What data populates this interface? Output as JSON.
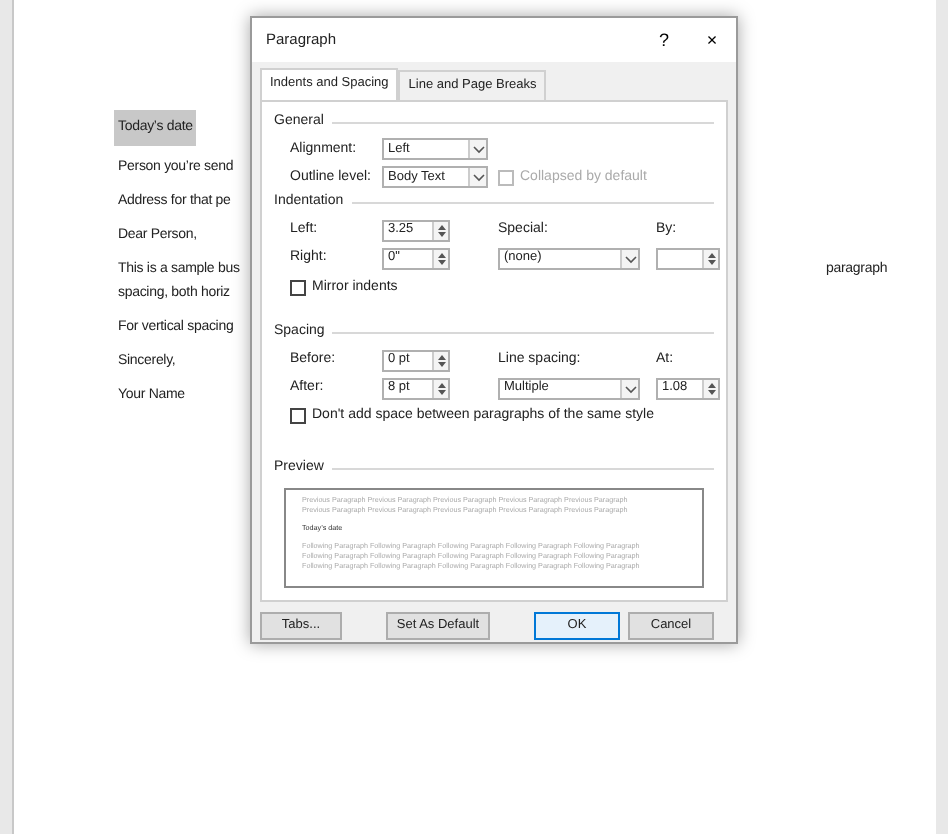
{
  "document": {
    "paragraphs": [
      {
        "lines": [
          "Today’s date"
        ],
        "highlighted": true
      },
      {
        "lines": [
          "Person you’re send"
        ],
        "highlighted": false
      },
      {
        "lines": [
          "Address for that pe"
        ],
        "highlighted": false
      },
      {
        "lines": [
          "Dear Person,"
        ],
        "highlighted": false
      },
      {
        "lines": [
          "This is a sample bus",
          "spacing, both horiz"
        ],
        "highlighted": false,
        "continuation": "paragraph"
      },
      {
        "lines": [
          "For vertical spacing"
        ],
        "highlighted": false
      },
      {
        "lines": [
          "Sincerely,"
        ],
        "highlighted": false
      },
      {
        "lines": [
          "Your Name"
        ],
        "highlighted": false
      }
    ]
  },
  "dialog": {
    "title": "Paragraph",
    "help": "?",
    "close": "×",
    "tabs": [
      {
        "label": "Indents and Spacing",
        "selected": true
      },
      {
        "label": "Line and Page Breaks",
        "selected": false
      }
    ],
    "general": {
      "heading": "General",
      "alignment": {
        "label": "Alignment:",
        "value": "Left"
      },
      "outline_level": {
        "label": "Outline level:",
        "value": "Body Text"
      },
      "collapsed": {
        "label": "Collapsed by default",
        "checked": false,
        "disabled": true
      }
    },
    "indentation": {
      "heading": "Indentation",
      "left": {
        "label": "Left:",
        "value": "3.25"
      },
      "right": {
        "label": "Right:",
        "value": "0\""
      },
      "special": {
        "label": "Special:",
        "value": "(none)"
      },
      "by": {
        "label": "By:"
      },
      "mirror": {
        "label": "Mirror indents",
        "checked": false,
        "disabled": false
      }
    },
    "spacing": {
      "heading": "Spacing",
      "before": {
        "label": "Before:",
        "value": "0 pt"
      },
      "after": {
        "label": "After:",
        "value": "8 pt"
      },
      "line_spacing": {
        "label": "Line spacing:",
        "value": "Multiple"
      },
      "at": {
        "label": "At:",
        "value": "1.08"
      },
      "dont_add": {
        "label": "Don't add space between paragraphs of the same style",
        "checked": false,
        "disabled": false
      }
    },
    "preview": {
      "heading": "Preview",
      "previous": [
        "Previous Paragraph Previous Paragraph Previous Paragraph Previous Paragraph Previous Paragraph",
        "Previous Paragraph Previous Paragraph Previous Paragraph Previous Paragraph Previous Paragraph"
      ],
      "current": "Today’s date",
      "following": [
        "Following Paragraph Following Paragraph Following Paragraph Following Paragraph Following Paragraph",
        "Following Paragraph Following Paragraph Following Paragraph Following Paragraph Following Paragraph",
        "Following Paragraph Following Paragraph Following Paragraph Following Paragraph Following Paragraph"
      ]
    },
    "buttons": [
      {
        "label": "Tabs...",
        "default": false
      },
      {
        "label": "Set As Default",
        "default": false
      },
      {
        "label": "OK",
        "default": true
      },
      {
        "label": "Cancel",
        "default": false
      }
    ]
  }
}
